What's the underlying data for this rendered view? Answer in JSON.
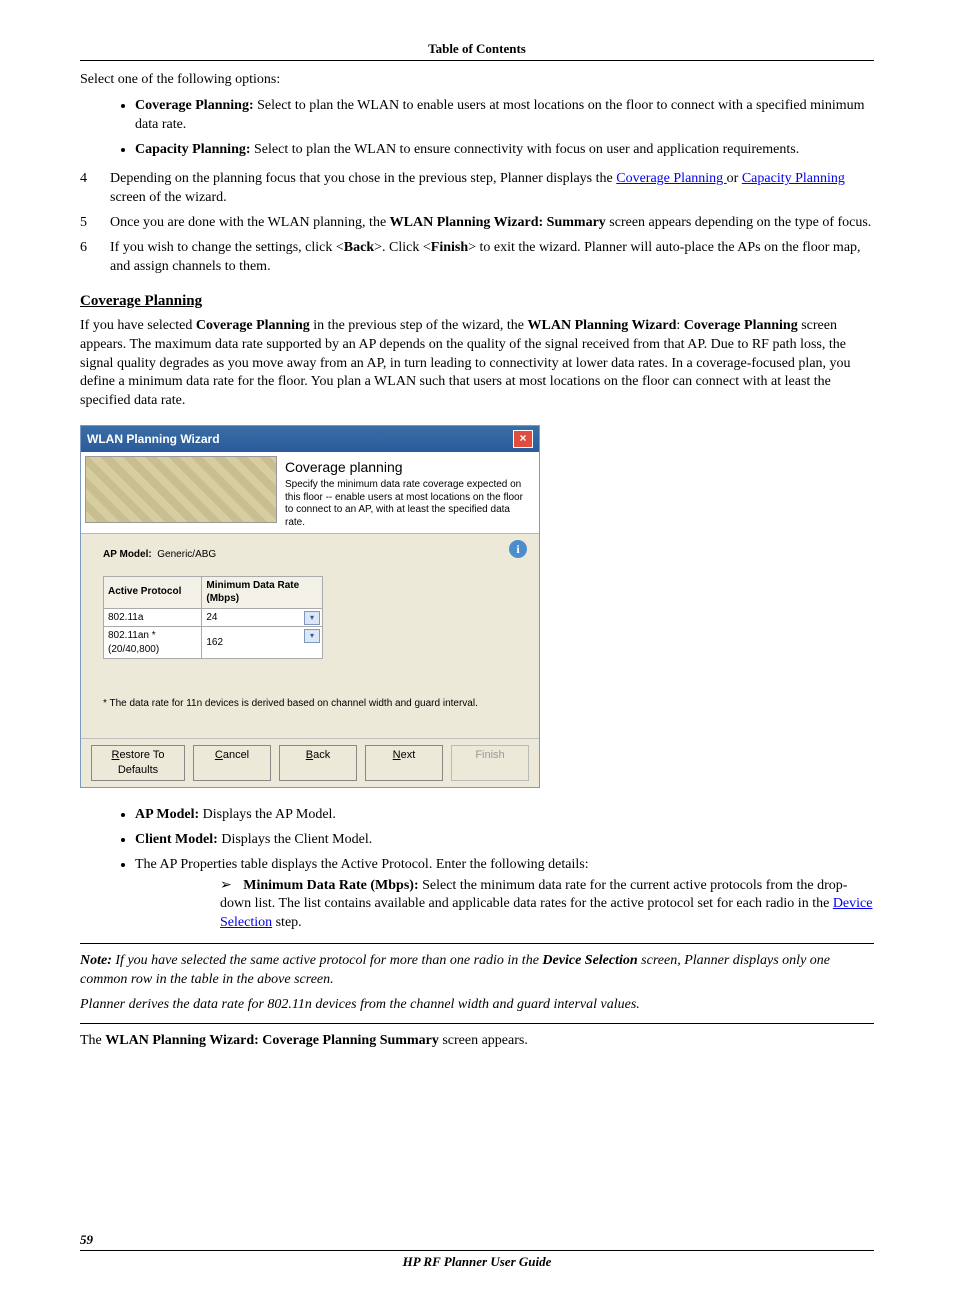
{
  "header_link": "Table of Contents",
  "intro": "Select one of the following options:",
  "options": {
    "coverage_label": "Coverage Planning:",
    "coverage_text": " Select to plan the WLAN to enable users at most locations on the floor to connect with a specified minimum data rate.",
    "capacity_label": "Capacity Planning:",
    "capacity_text": " Select to plan the WLAN to ensure connectivity with focus on user and application requirements."
  },
  "steps": {
    "s4a": "Depending on the planning focus that you chose in the previous step, Planner displays the ",
    "s4_link1": "Coverage Planning ",
    "s4_mid": "or ",
    "s4_link2": "Capacity Planning",
    "s4b": " screen of the wizard.",
    "s5a": "Once you are done with the WLAN planning, the ",
    "s5_bold": "WLAN Planning Wizard: Summary",
    "s5b": " screen appears depending on the type of focus.",
    "s6a": "If you wish to change the settings, click <",
    "s6_b1": "Back",
    "s6b": ">. Click <",
    "s6_b2": "Finish",
    "s6c": "> to exit the wizard. Planner will auto-place the APs on the floor map, and assign channels to them."
  },
  "section_title": "Coverage Planning",
  "section_para_a": "If you have selected ",
  "section_para_b1": "Coverage Planning",
  "section_para_b": " in the previous step of the wizard, the ",
  "section_para_b2": "WLAN Planning Wizard",
  "section_para_colon": ": ",
  "section_para_b3": "Coverage Planning",
  "section_para_c": " screen appears. The maximum data rate supported by an AP depends on the quality of the signal received from that AP. Due to RF path loss, the signal quality degrades as you move away from an AP, in turn leading to connectivity at lower data rates. In a coverage-focused plan, you define a minimum data rate for the floor. You plan a WLAN such that users at most locations on the floor can connect with at least the specified data rate.",
  "wizard": {
    "title": "WLAN Planning Wizard",
    "heading": "Coverage planning",
    "desc": "Specify the minimum data rate coverage expected on this floor -- enable users at most locations on the floor to connect to an AP, with at least the specified data rate.",
    "ap_model_label": "AP Model:",
    "ap_model_value": "Generic/ABG",
    "col1": "Active Protocol",
    "col2": "Minimum Data Rate (Mbps)",
    "rows": [
      {
        "proto": "802.11a",
        "rate": "24"
      },
      {
        "proto": "802.11an *(20/40,800)",
        "rate": "162"
      }
    ],
    "footnote": "* The data rate for 11n devices is derived based on channel width and guard interval.",
    "btn_restore": "Restore To Defaults",
    "btn_cancel": "Cancel",
    "btn_back": "Back",
    "btn_next": "Next",
    "btn_finish": "Finish"
  },
  "after_list": {
    "ap_label": "AP Model:",
    "ap_text": " Displays the AP Model.",
    "client_label": "Client Model:",
    "client_text": " Displays the Client Model.",
    "table_text": "The AP Properties table displays the Active Protocol. Enter the following details:",
    "min_label": "Minimum Data Rate (Mbps):",
    "min_text_a": " Select the minimum data rate for the current active protocols from the drop-down list. The list contains available and applicable data rates for the active protocol set for each radio in the ",
    "min_link": "Device Selection",
    "min_text_b": " step."
  },
  "note1_a": "Note:",
  "note1_b": " If you have selected the same active protocol for more than one radio in the ",
  "note1_bold": "Device Selection",
  "note1_c": " screen, Planner displays only one common row in the table in the above screen.",
  "note2": "Planner derives the data rate for 802.11n devices from the channel width and guard interval values.",
  "final_a": "The ",
  "final_bold": "WLAN Planning Wizard: Coverage Planning Summary",
  "final_b": " screen appears.",
  "page_num": "59",
  "footer_title": "HP RF Planner User Guide"
}
